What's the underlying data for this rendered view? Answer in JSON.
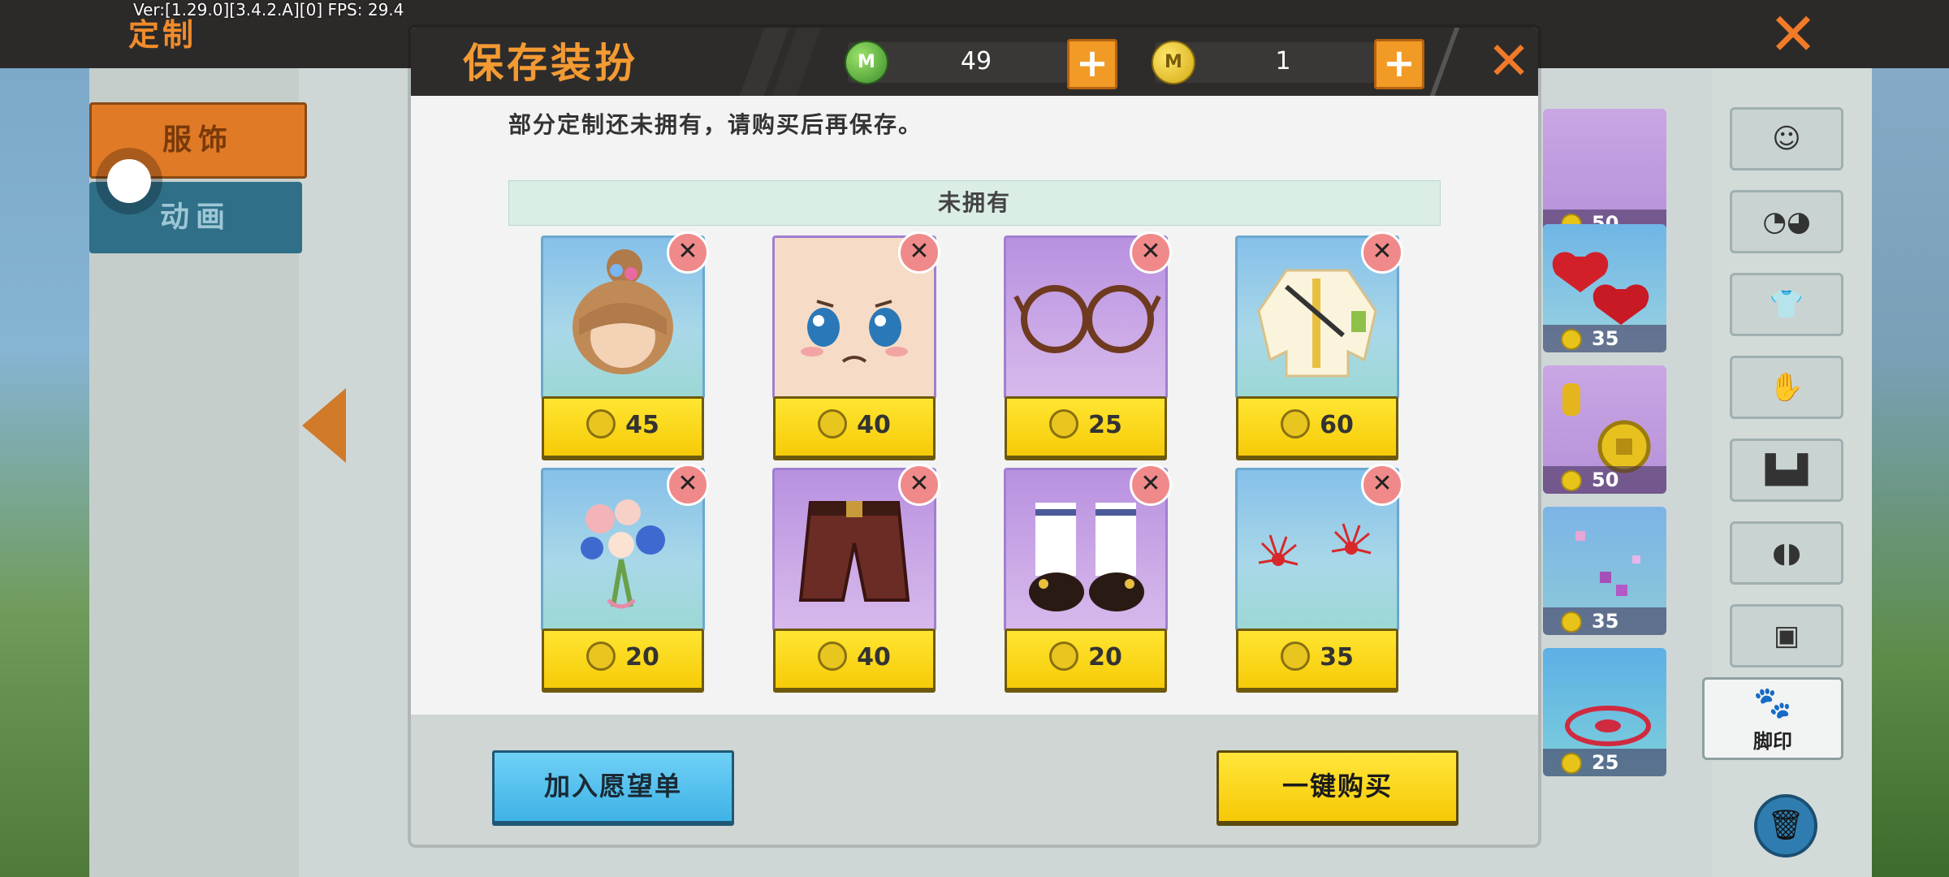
{
  "hud": {
    "version": "Ver:[1.29.0][3.4.2.A][0] FPS: 29.4"
  },
  "page": {
    "title": "定制",
    "close_icon": "close-icon"
  },
  "tabs": [
    {
      "label": "服饰",
      "active": true
    },
    {
      "label": "动画",
      "active": false
    }
  ],
  "side_items": [
    {
      "price": "50"
    },
    {
      "price": "35"
    },
    {
      "price": "50"
    },
    {
      "price": "35"
    },
    {
      "price": "25"
    }
  ],
  "categories": [
    {
      "icon": "face-icon"
    },
    {
      "icon": "mask-icon"
    },
    {
      "icon": "shirt-icon"
    },
    {
      "icon": "gloves-icon"
    },
    {
      "icon": "pants-icon"
    },
    {
      "icon": "shoes-icon"
    },
    {
      "icon": "backpack-icon"
    },
    {
      "icon": "paw-icon",
      "label": "脚印"
    }
  ],
  "dialog": {
    "title": "保存装扮",
    "currency": {
      "green_value": "49",
      "gold_value": "1"
    },
    "notice": "部分定制还未拥有，请购买后再保存。",
    "section_title": "未拥有",
    "items": [
      {
        "name": "hair-bun",
        "bg": "blue",
        "price": "45"
      },
      {
        "name": "teary-face",
        "bg": "skin",
        "price": "40"
      },
      {
        "name": "round-glasses",
        "bg": "purple",
        "price": "25"
      },
      {
        "name": "white-jacket",
        "bg": "blue",
        "price": "60"
      },
      {
        "name": "flower-bouquet",
        "bg": "blue",
        "price": "20"
      },
      {
        "name": "brown-shorts",
        "bg": "purple",
        "price": "40"
      },
      {
        "name": "sailor-shoes",
        "bg": "purple",
        "price": "20"
      },
      {
        "name": "red-spider-lilies",
        "bg": "blue",
        "price": "35"
      }
    ],
    "wishlist_label": "加入愿望单",
    "buy_all_label": "一键购买"
  },
  "colors": {
    "accent": "#f08b2c",
    "price_button": "#f6cb08",
    "wishlist_button": "#3fb3e6",
    "remove_button": "#f08a8a"
  }
}
